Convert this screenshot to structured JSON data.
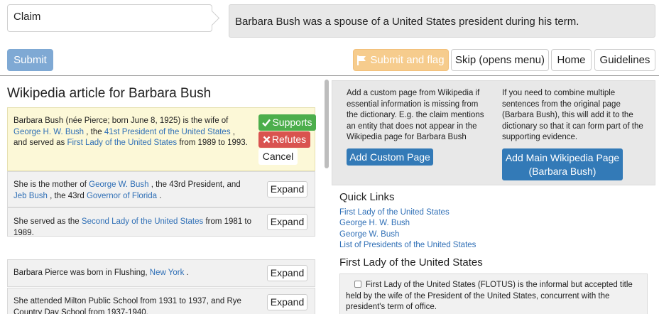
{
  "claim": {
    "label": "Claim",
    "text": "Barbara Bush was a spouse of a United States president during his term."
  },
  "toolbar": {
    "submit": "Submit",
    "submit_flag": "Submit and flag",
    "skip": "Skip (opens menu)",
    "home": "Home",
    "guidelines": "Guidelines"
  },
  "article": {
    "title": "Wikipedia article for Barbara Bush",
    "active_sentence": {
      "parts": [
        "Barbara Bush (née Pierce; born June 8, 1925) is the wife of ",
        "George H. W. Bush",
        " , the ",
        "41st President of the United States",
        " , and served as ",
        "First Lady of the United States",
        " from 1989 to 1993."
      ],
      "supports": "Supports",
      "refutes": "Refutes",
      "cancel": "Cancel"
    },
    "sentences": [
      {
        "p1": "She is the mother of ",
        "l1": "George W. Bush",
        "p2": " , the 43rd President, and ",
        "l2": "Jeb Bush",
        "p3": " , the 43rd ",
        "l3": "Governor of Florida",
        "p4": " ."
      },
      {
        "p1": "She served as the ",
        "l1": "Second Lady of the United States",
        "p2": " from 1981 to 1989."
      },
      {
        "p1": "Barbara Pierce was born in Flushing, ",
        "l1": "New York",
        "p2": " ."
      },
      {
        "p1": "She attended Milton Public School from 1931 to 1937, and Rye Country Day School from 1937-1940."
      }
    ],
    "expand_label": "Expand"
  },
  "sidebar": {
    "custom_page_info": "Add a custom page from Wikipedia if essential information is missing from the dictionary. E.g. the claim mentions an entity that does not appear in the Wikipedia page for Barbara Bush",
    "custom_page_button": "Add Custom Page",
    "main_page_info": "If you need to combine multiple sentences from the original page (Barbara Bush), this will add it to the dictionary so that it can form part of the supporting evidence.",
    "main_page_button_line1": "Add Main Wikipedia Page",
    "main_page_button_line2": "(Barbara Bush)",
    "quick_links_title": "Quick Links",
    "quick_links": [
      "First Lady of the United States",
      "George H. W. Bush",
      "George W. Bush",
      "List of Presidents of the United States"
    ],
    "section_title": "First Lady of the United States",
    "section_sentence": "First Lady of the United States (FLOTUS) is the informal but accepted title held by the wife of the President of the United States, concurrent with the president's term of office."
  },
  "colors": {
    "primary": "#337ab7",
    "submit_disabled": "#7fa9d4",
    "flag": "#f6cc8d",
    "supports": "#4cae4c",
    "refutes": "#d9534f",
    "highlight": "#fcf8d7",
    "link": "#2f6fb6"
  },
  "icons": {
    "flag": "flag-icon",
    "check": "check-icon",
    "cross": "cross-icon"
  }
}
